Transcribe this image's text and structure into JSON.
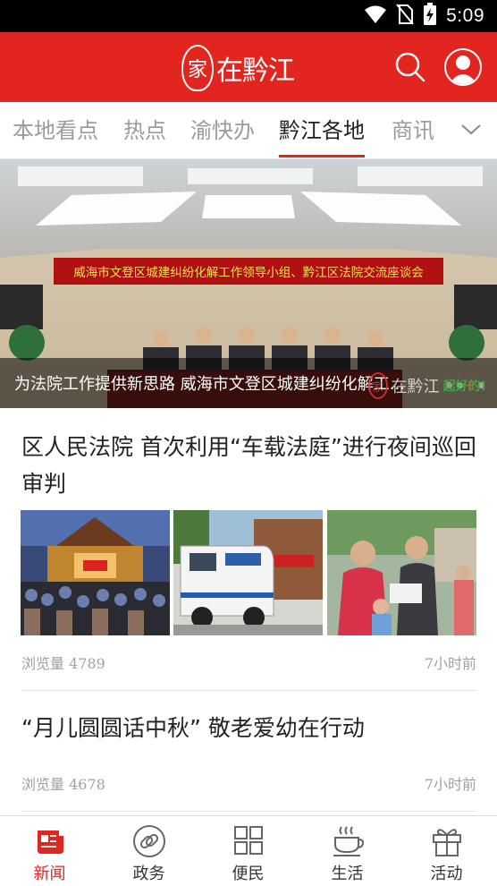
{
  "status_bar": {
    "time": "5:09",
    "icons": [
      "wifi-icon",
      "no-sim-icon",
      "battery-charging-icon"
    ]
  },
  "header": {
    "logo_badge": "家",
    "logo_text": "在黔江",
    "search_icon": "search-icon",
    "user_icon": "user-icon",
    "brand_color": "#e2251e"
  },
  "tabs": [
    {
      "label": "本地看点",
      "active": false
    },
    {
      "label": "热点",
      "active": false
    },
    {
      "label": "渝快办",
      "active": false
    },
    {
      "label": "黔江各地",
      "active": true
    },
    {
      "label": "商讯",
      "active": false
    }
  ],
  "tabs_more_icon": "chevron-down-icon",
  "banner": {
    "banner_text": "威海市文登区城建纠纷化解工作领导小组、黔江区法院交流座谈会",
    "caption": "为法院工作提供新思路  威海市文登区城建纠纷化解工...",
    "watermark": "在黔江",
    "watermark_badge": "家",
    "watermark_slogan": "起好的!",
    "active_dot_index": 2,
    "dot_count": 4
  },
  "articles": [
    {
      "title": "区人民法院  首次利用“车载法庭”进行夜间巡回审判",
      "views": "浏览量 4789",
      "time": "7小时前"
    },
    {
      "title": "“月儿圆圆话中秋” 敬老爱幼在行动",
      "views": "浏览量 4678",
      "time": "7小时前"
    }
  ],
  "bottom_nav": [
    {
      "label": "新闻",
      "icon": "news-icon",
      "active": true
    },
    {
      "label": "政务",
      "icon": "link-icon",
      "active": false
    },
    {
      "label": "便民",
      "icon": "grid-icon",
      "active": false
    },
    {
      "label": "生活",
      "icon": "coffee-cup-icon",
      "active": false
    },
    {
      "label": "活动",
      "icon": "gift-icon",
      "active": false
    }
  ]
}
